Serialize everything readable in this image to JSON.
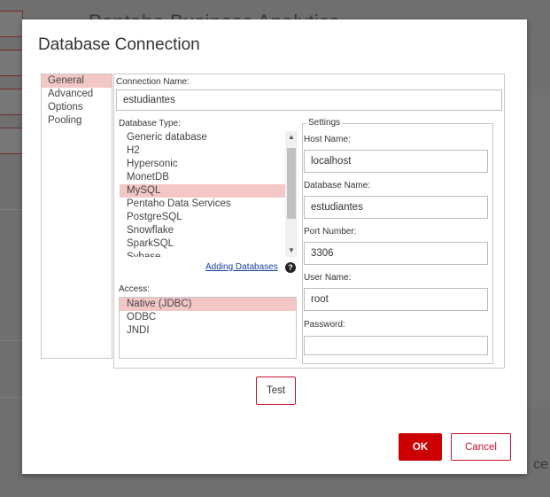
{
  "background": {
    "title": "Pentaho Business Analytics",
    "right_text": "ce"
  },
  "dialog": {
    "title": "Database Connection",
    "nav": [
      {
        "label": "General",
        "selected": true
      },
      {
        "label": "Advanced",
        "selected": false
      },
      {
        "label": "Options",
        "selected": false
      },
      {
        "label": "Pooling",
        "selected": false
      }
    ],
    "connection_name": {
      "label": "Connection Name:",
      "value": "estudiantes"
    },
    "database_type": {
      "label": "Database Type:",
      "items": [
        "Generic database",
        "H2",
        "Hypersonic",
        "MonetDB",
        "MySQL",
        "Pentaho Data Services",
        "PostgreSQL",
        "Snowflake",
        "SparkSQL",
        "Sybase"
      ],
      "selected": "MySQL",
      "help_link": "Adding Databases"
    },
    "access": {
      "label": "Access:",
      "items": [
        "Native (JDBC)",
        "ODBC",
        "JNDI"
      ],
      "selected": "Native (JDBC)"
    },
    "settings": {
      "legend": "Settings",
      "host_name": {
        "label": "Host Name:",
        "value": "localhost"
      },
      "database_name": {
        "label": "Database Name:",
        "value": "estudiantes"
      },
      "port_number": {
        "label": "Port Number:",
        "value": "3306"
      },
      "user_name": {
        "label": "User Name:",
        "value": "root"
      },
      "password": {
        "label": "Password:",
        "value": ""
      }
    },
    "buttons": {
      "test": "Test",
      "ok": "OK",
      "cancel": "Cancel"
    },
    "colors": {
      "accent": "#cc0000",
      "selection": "#f4c7c7"
    }
  }
}
